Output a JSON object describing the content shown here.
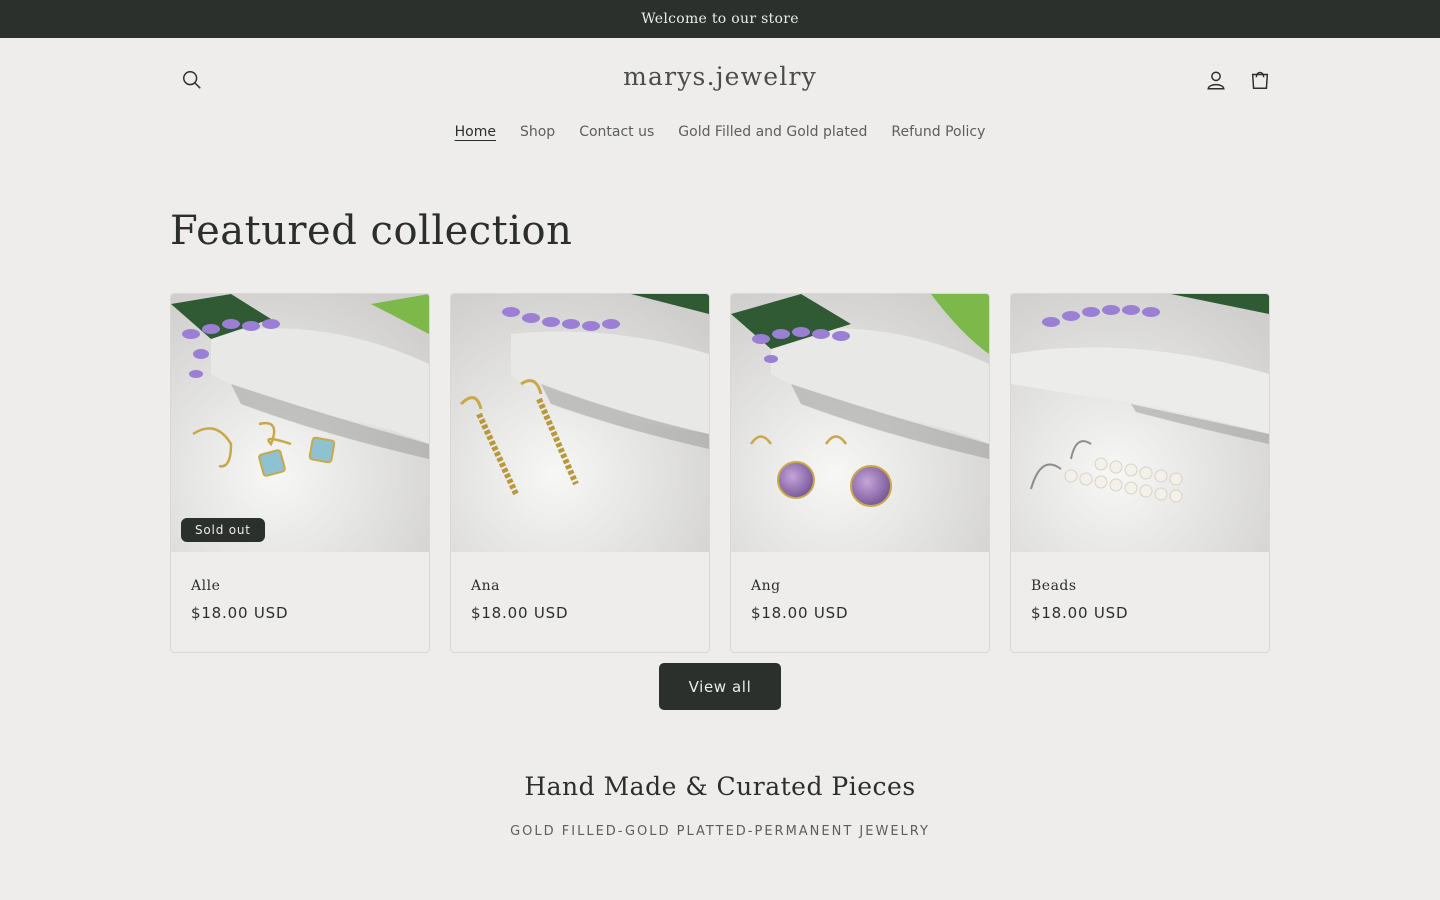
{
  "announcement": "Welcome to our store",
  "header": {
    "logo": "marys.jewelry",
    "icons": [
      "search-icon",
      "account-icon",
      "cart-icon"
    ]
  },
  "nav": {
    "items": [
      {
        "label": "Home",
        "active": true
      },
      {
        "label": "Shop"
      },
      {
        "label": "Contact us"
      },
      {
        "label": "Gold Filled and Gold plated"
      },
      {
        "label": "Refund Policy"
      }
    ]
  },
  "featured": {
    "heading": "Featured collection",
    "products": [
      {
        "title": "Alle",
        "price": "$18.00 USD",
        "badge": "Sold out"
      },
      {
        "title": "Ana",
        "price": "$18.00 USD"
      },
      {
        "title": "Ang",
        "price": "$18.00 USD"
      },
      {
        "title": "Beads",
        "price": "$18.00 USD"
      }
    ],
    "view_all": "View all"
  },
  "handmade": {
    "heading": "Hand Made & Curated Pieces",
    "subheading": "GOLD FILLED-GOLD PLATTED-PERMANENT JEWELRY"
  },
  "colors": {
    "background": "#eeedeb",
    "dark": "#2b302d",
    "lavender": "#9b7fd4",
    "gold": "#c9a84a"
  }
}
